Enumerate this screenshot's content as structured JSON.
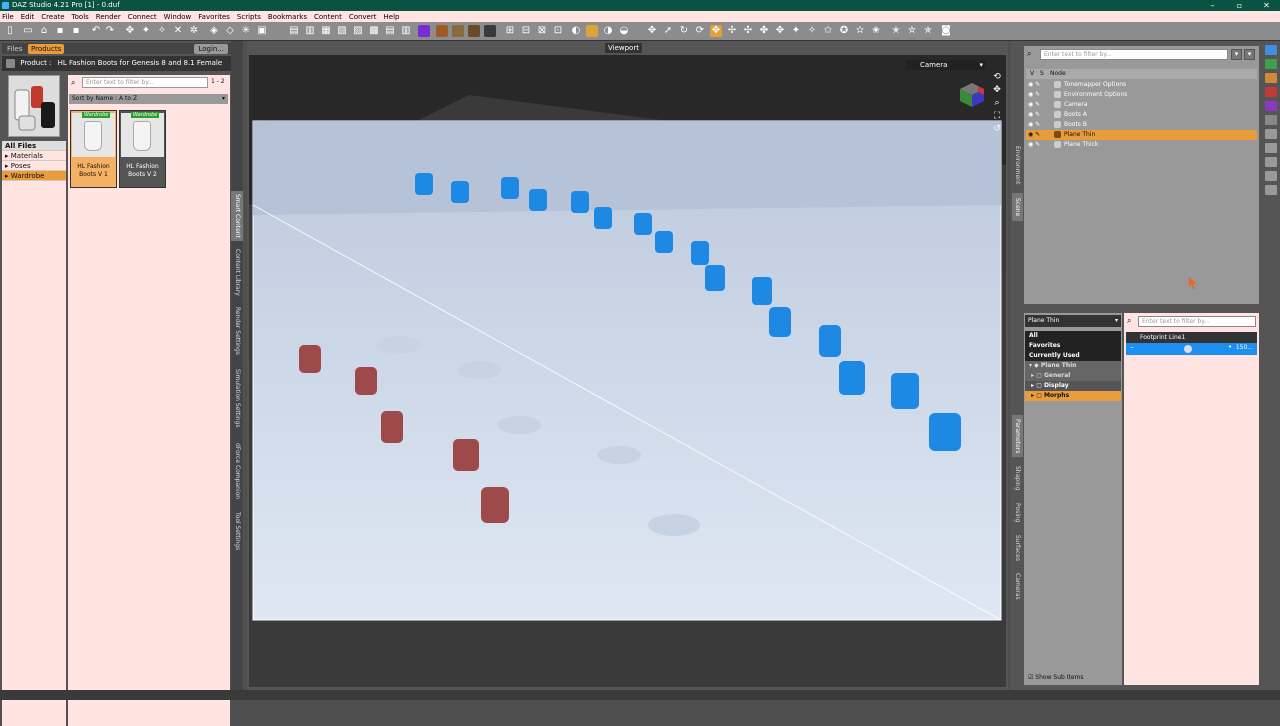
{
  "window": {
    "title": "DAZ Studio 4.21 Pro [1] - 0.duf"
  },
  "menu": [
    "File",
    "Edit",
    "Create",
    "Tools",
    "Render",
    "Connect",
    "Window",
    "Favorites",
    "Scripts",
    "Bookmarks",
    "Content",
    "Convert",
    "Help"
  ],
  "left_panel": {
    "tabs": [
      "Files",
      "Products"
    ],
    "login": "Login...",
    "product_label": "Product",
    "product_title": "HL Fashion Boots for Genesis 8 and 8.1 Female",
    "filter_placeholder": "Enter text to filter by...",
    "page_count": "1 - 2",
    "sort": "Sort by Name : A to Z",
    "categories": [
      {
        "label": "All Files"
      },
      {
        "label": "Materials"
      },
      {
        "label": "Poses"
      },
      {
        "label": "Wardrobe"
      }
    ],
    "cards": [
      {
        "badge": "Wardrobe",
        "label": "HL Fashion Boots V 1"
      },
      {
        "badge": "Wardrobe",
        "label": "HL Fashion Boots V 2"
      }
    ],
    "side_tabs": [
      "Smart Content",
      "Content Library",
      "Render Settings",
      "Simulation Settings",
      "dForce Companion",
      "Tool Settings"
    ]
  },
  "viewport": {
    "title": "Viewport",
    "camera": "Camera",
    "aspect": "3 : 2"
  },
  "scene_panel": {
    "filter_placeholder": "Enter text to filter by...",
    "columns": [
      "V",
      "S",
      "Node"
    ],
    "nodes": [
      {
        "label": "Tonemapper Options"
      },
      {
        "label": "Environment Options"
      },
      {
        "label": "Camera"
      },
      {
        "label": "Boots A"
      },
      {
        "label": "Boots B"
      },
      {
        "label": "Plane Thin"
      },
      {
        "label": "Plane Thick"
      }
    ],
    "side_tabs": [
      "Environment",
      "Scene"
    ]
  },
  "parameters_panel": {
    "selected_node": "Plane Thin",
    "groups": [
      "All",
      "Favorites",
      "Currently Used",
      "Plane Thin",
      "General",
      "Display",
      "Morphs"
    ],
    "filter_placeholder": "Enter text to filter by...",
    "property": "Footprint Line1",
    "value_text": "150...",
    "show_sub_items": "Show Sub Items",
    "side_tabs": [
      "Parameters",
      "Shaping",
      "Posing",
      "Surfaces",
      "Cameras"
    ]
  },
  "colors": {
    "accent": "#e89c3a",
    "titlebar": "#0a5244",
    "slider": "#1e8ef0"
  }
}
